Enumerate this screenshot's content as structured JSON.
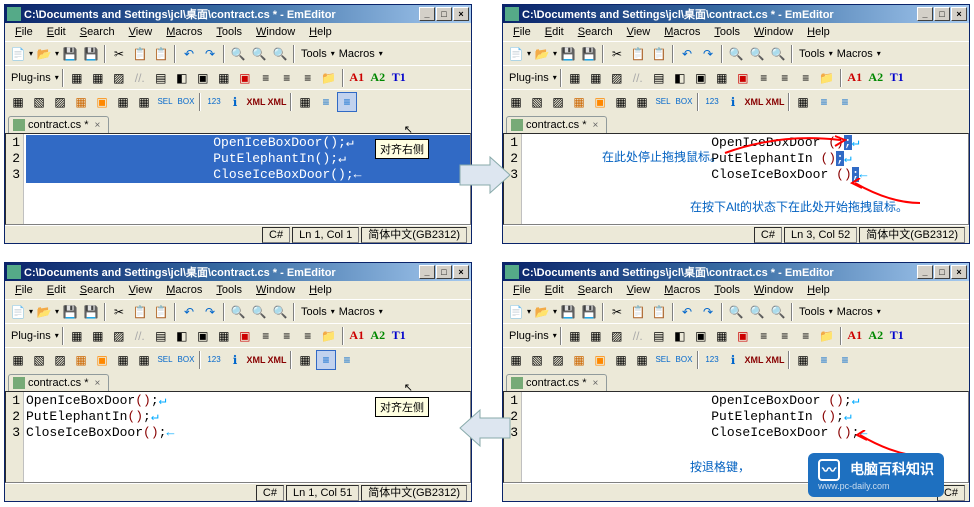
{
  "windows": {
    "w1": {
      "title": "C:\\Documents and Settings\\jcl\\桌面\\contract.cs * - EmEditor",
      "tab": "contract.cs *",
      "status_lang": "C#",
      "status_pos": "Ln 1, Col 1",
      "status_enc": "简体中文(GB2312)",
      "lines": [
        {
          "num": "1",
          "text": "                        OpenIceBoxDoor",
          "paren": "()",
          "sel": true
        },
        {
          "num": "2",
          "text": "                        PutElephantIn",
          "paren": "()",
          "sel": true
        },
        {
          "num": "3",
          "text": "                        CloseIceBoxDoor",
          "paren": "()",
          "sel": true
        }
      ],
      "tooltip": "对齐右侧"
    },
    "w2": {
      "title": "C:\\Documents and Settings\\jcl\\桌面\\contract.cs * - EmEditor",
      "tab": "contract.cs *",
      "status_lang": "C#",
      "status_pos": "Ln 3, Col 52",
      "status_enc": "简体中文(GB2312)",
      "lines": [
        {
          "num": "1",
          "text": "                        OpenIceBoxDoor ",
          "paren": "()",
          "sel": false
        },
        {
          "num": "2",
          "text": "                        PutElephantIn ",
          "paren": "()",
          "sel": false
        },
        {
          "num": "3",
          "text": "                        CloseIceBoxDoor ",
          "paren": "()",
          "sel": false
        }
      ],
      "annot1": "在此处停止拖拽鼠标。",
      "annot2": "在按下Alt的状态下在此处开始拖拽鼠标。"
    },
    "w3": {
      "title": "C:\\Documents and Settings\\jcl\\桌面\\contract.cs * - EmEditor",
      "tab": "contract.cs *",
      "status_lang": "C#",
      "status_pos": "Ln 1, Col 51",
      "status_enc": "简体中文(GB2312)",
      "lines": [
        {
          "num": "1",
          "text": "OpenIceBoxDoor",
          "paren": "()",
          "sel": false
        },
        {
          "num": "2",
          "text": "PutElephantIn",
          "paren": "()",
          "sel": false
        },
        {
          "num": "3",
          "text": "CloseIceBoxDoor",
          "paren": "()",
          "sel": false
        }
      ],
      "tooltip": "对齐左侧"
    },
    "w4": {
      "title": "C:\\Documents and Settings\\jcl\\桌面\\contract.cs * - EmEditor",
      "tab": "contract.cs *",
      "status_lang": "C#",
      "lines": [
        {
          "num": "1",
          "text": "                        OpenIceBoxDoor ",
          "paren": "()",
          "sel": false
        },
        {
          "num": "2",
          "text": "                        PutElephantIn ",
          "paren": "()",
          "sel": false
        },
        {
          "num": "3",
          "text": "                        CloseIceBoxDoor ",
          "paren": "()",
          "sel": false
        }
      ],
      "annot": "按退格键，"
    }
  },
  "menu": {
    "file": "File",
    "edit": "Edit",
    "search": "Search",
    "view": "View",
    "macros": "Macros",
    "tools": "Tools",
    "window": "Window",
    "help": "Help"
  },
  "toolbar": {
    "tools": "Tools",
    "macros": "Macros",
    "plugins": "Plug-ins",
    "a1": "A1",
    "a2": "A2",
    "t1": "T1",
    "xmle": "XML",
    "xmlx": "XML"
  },
  "winbtns": {
    "min": "_",
    "max": "□",
    "close": "×"
  },
  "watermark": {
    "main": "电脑百科知识",
    "sub": "www.pc-daily.com"
  }
}
